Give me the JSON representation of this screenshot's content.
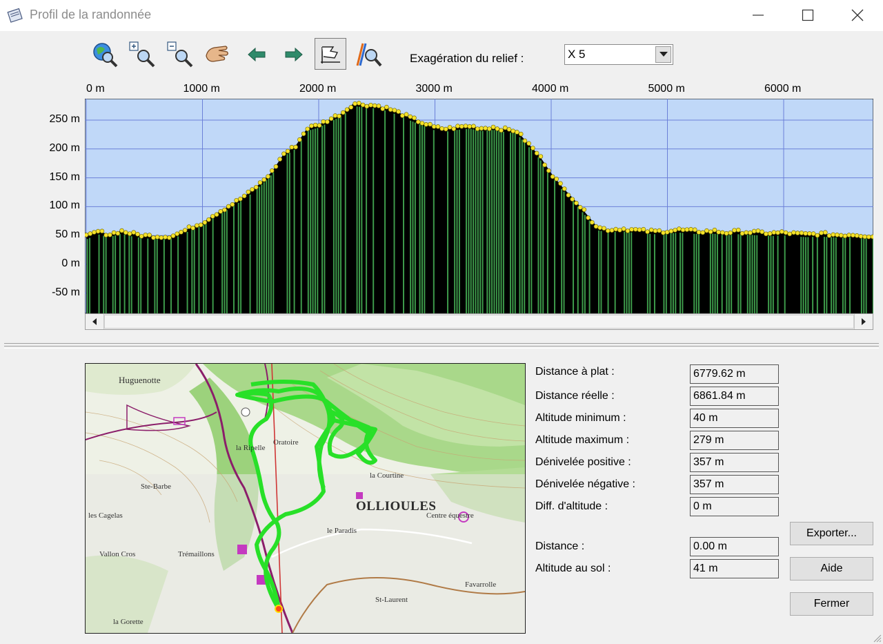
{
  "window": {
    "title": "Profil de la randonnée",
    "icon": "notebook-icon",
    "controls": [
      "minimize-icon",
      "maximize-icon",
      "close-icon"
    ]
  },
  "toolbar": {
    "icons": [
      "globe-zoom-icon",
      "zoom-in-icon",
      "zoom-out-icon",
      "pan-hand-icon",
      "arrow-left-icon",
      "arrow-right-icon",
      "flag-pin-icon",
      "route-zoom-icon"
    ],
    "relief_label": "Exagération du relief :",
    "relief_value": "X 5"
  },
  "chart_data": {
    "type": "area",
    "xlabel": "",
    "ylabel": "",
    "x_ticks": [
      "0 m",
      "1000 m",
      "2000 m",
      "3000 m",
      "4000 m",
      "5000 m",
      "6000 m"
    ],
    "y_ticks": [
      "250 m",
      "200 m",
      "150 m",
      "100 m",
      "50 m",
      "0 m",
      "-50 m"
    ],
    "xlim": [
      0,
      6780
    ],
    "ylim": [
      -80,
      290
    ],
    "grid": true,
    "colors": {
      "background": "#c0d8f8",
      "fill": "#000000",
      "bars": "#3d9a4a",
      "points": "#f5e22c",
      "grid": "#6b80d8"
    },
    "x": [
      0,
      100,
      200,
      300,
      400,
      500,
      600,
      700,
      800,
      900,
      1000,
      1100,
      1200,
      1300,
      1400,
      1500,
      1600,
      1700,
      1800,
      1900,
      2000,
      2100,
      2200,
      2300,
      2400,
      2500,
      2600,
      2700,
      2800,
      2900,
      3000,
      3100,
      3200,
      3300,
      3400,
      3500,
      3600,
      3700,
      3800,
      3900,
      4000,
      4100,
      4200,
      4300,
      4400,
      4500,
      4600,
      4700,
      4800,
      4900,
      5000,
      5100,
      5200,
      5300,
      5400,
      5500,
      5600,
      5700,
      5800,
      5900,
      6000,
      6100,
      6200,
      6300,
      6400,
      6500,
      6600,
      6700,
      6780
    ],
    "values": [
      48,
      57,
      52,
      58,
      53,
      50,
      49,
      48,
      54,
      64,
      72,
      86,
      98,
      110,
      124,
      141,
      161,
      192,
      205,
      236,
      242,
      252,
      262,
      279,
      277,
      275,
      270,
      262,
      253,
      245,
      237,
      235,
      238,
      240,
      236,
      238,
      234,
      232,
      210,
      188,
      158,
      133,
      112,
      88,
      64,
      60,
      62,
      60,
      58,
      57,
      58,
      60,
      58,
      57,
      58,
      55,
      57,
      56,
      55,
      54,
      55,
      53,
      52,
      53,
      52,
      51,
      52,
      50,
      49
    ]
  },
  "map": {
    "labels": {
      "huguenotte": "Huguenotte",
      "oratoire": "Oratoire",
      "ripelle": "la Ripelle",
      "courtine": "la Courtine",
      "ollioules": "OLLIOULES",
      "sainte_barbe": "Ste-Barbe",
      "cagelas": "les Cagelas",
      "vallon_cros": "Vallon Cros",
      "tremaillons": "Trémaillons",
      "paradis": "le Paradis",
      "st_laurent": "St-Laurent",
      "la_gorette": "la Gorette",
      "favarrolle": "Favarrolle",
      "centre": "Centre équestre"
    }
  },
  "stats": [
    {
      "label": "Distance à plat :",
      "value": "6779.62 m"
    },
    {
      "label": "Distance réelle :",
      "value": "6861.84 m"
    },
    {
      "label": "Altitude minimum :",
      "value": "40 m"
    },
    {
      "label": "Altitude maximum :",
      "value": "279 m"
    },
    {
      "label": "Dénivelée positive :",
      "value": "357 m"
    },
    {
      "label": "Dénivelée négative :",
      "value": "357 m"
    },
    {
      "label": "Diff. d'altitude :",
      "value": "0 m"
    },
    {
      "label": "Distance :",
      "value": "0.00 m"
    },
    {
      "label": "Altitude au sol :",
      "value": "41 m"
    }
  ],
  "buttons": {
    "export": "Exporter...",
    "help": "Aide",
    "close": "Fermer"
  }
}
